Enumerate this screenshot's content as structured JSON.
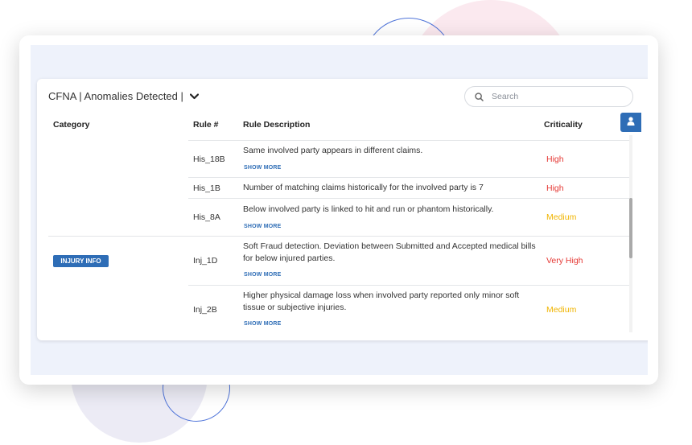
{
  "panel": {
    "title": "CFNA | Anomalies Detected |",
    "search": {
      "placeholder": "Search"
    }
  },
  "table": {
    "headers": {
      "category": "Category",
      "rule": "Rule #",
      "description": "Rule Description",
      "criticality": "Criticality"
    },
    "categories": [
      "INJURY INFO"
    ],
    "show_more_label": "SHOW MORE",
    "rows": [
      {
        "rule": "His_18B",
        "description": "Same involved party appears in different claims.",
        "show_more": true,
        "criticality": "High"
      },
      {
        "rule": "His_1B",
        "description": "Number of matching claims historically for the involved party is 7",
        "show_more": false,
        "criticality": "High"
      },
      {
        "rule": "His_8A",
        "description": "Below involved party is linked to hit and run or phantom historically.",
        "show_more": true,
        "criticality": "Medium"
      },
      {
        "rule": "Inj_1D",
        "description": "Soft Fraud detection. Deviation between Submitted and Accepted medical bills for below injured parties.",
        "show_more": true,
        "criticality": "Very High"
      },
      {
        "rule": "Inj_2B",
        "description": "Higher physical damage loss when involved party reported only minor soft tissue or subjective injuries.",
        "show_more": true,
        "criticality": "Medium"
      }
    ]
  },
  "colors": {
    "accent": "#2e6db6",
    "high": "#e53935",
    "medium": "#f0b400",
    "screen_bg": "#eef2fb"
  },
  "icons": {
    "title_dropdown": "chevron-down-icon",
    "search": "search-icon",
    "user": "user-icon"
  }
}
